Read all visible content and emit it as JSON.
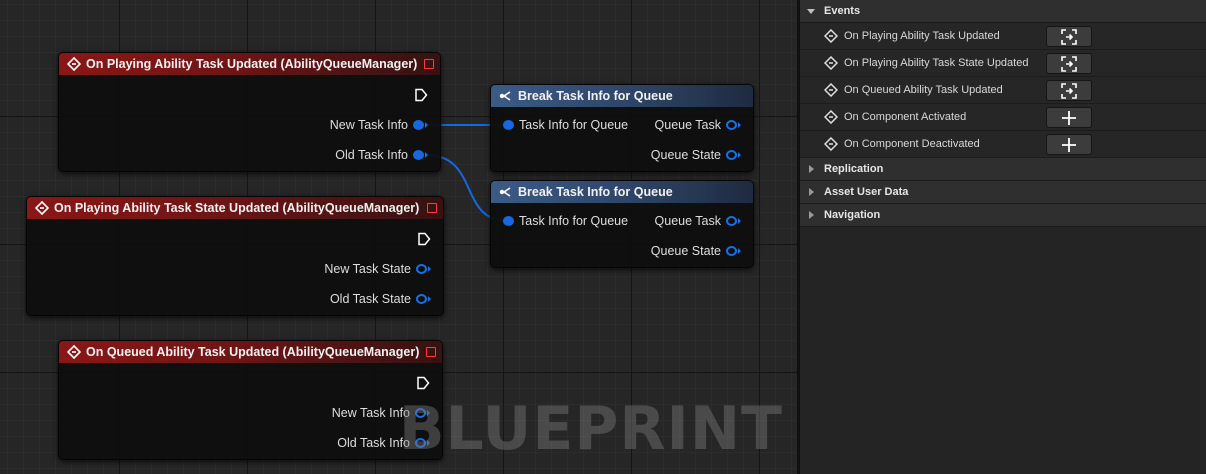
{
  "graph": {
    "watermark": "BLUEPRINT",
    "nodes": [
      {
        "title": "On Playing Ability Task Updated (AbilityQueueManager)",
        "pins": [
          "New Task Info",
          "Old Task Info"
        ]
      },
      {
        "title": "On Playing Ability Task State Updated (AbilityQueueManager)",
        "pins": [
          "New Task State",
          "Old Task State"
        ]
      },
      {
        "title": "On Queued Ability Task Updated (AbilityQueueManager)",
        "pins": [
          "New Task Info",
          "Old Task Info"
        ]
      },
      {
        "title": "Break Task Info for Queue",
        "input": "Task Info for Queue",
        "outputs": [
          "Queue Task",
          "Queue State"
        ]
      },
      {
        "title": "Break Task Info for Queue",
        "input": "Task Info for Queue",
        "outputs": [
          "Queue Task",
          "Queue State"
        ]
      }
    ]
  },
  "details": {
    "events_label": "Events",
    "events": [
      {
        "label": "On Playing Ability Task Updated",
        "button_icon": "go-to-node-icon"
      },
      {
        "label": "On Playing Ability Task State Updated",
        "button_icon": "go-to-node-icon"
      },
      {
        "label": "On Queued Ability Task Updated",
        "button_icon": "go-to-node-icon"
      },
      {
        "label": "On Component Activated",
        "button_icon": "plus-icon"
      },
      {
        "label": "On Component Deactivated",
        "button_icon": "plus-icon"
      }
    ],
    "categories": [
      "Replication",
      "Asset User Data",
      "Navigation"
    ]
  },
  "colors": {
    "event_header": "#8b1717",
    "pure_header": "#3b5b86",
    "struct_pin": "#1866e0",
    "close_square": "#ff3b3b"
  }
}
